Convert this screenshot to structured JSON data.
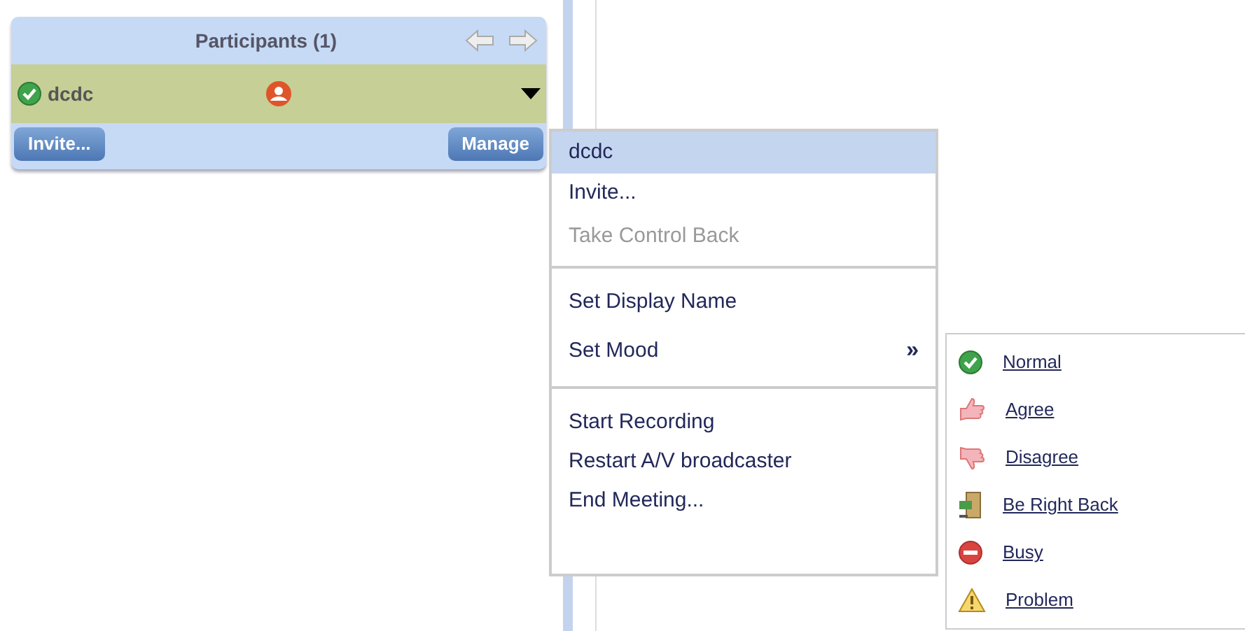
{
  "panel": {
    "title": "Participants (1)",
    "participants": [
      {
        "name": "dcdc",
        "selected": true
      }
    ],
    "buttons": [
      "Invite...",
      "Manage"
    ]
  },
  "menu": {
    "items": [
      {
        "kind": "header",
        "label": "dcdc"
      },
      {
        "kind": "item",
        "label": "Invite...",
        "disabled": false
      },
      {
        "kind": "item",
        "label": "Take Control Back",
        "disabled": true
      },
      {
        "kind": "separator"
      },
      {
        "kind": "item",
        "label": "Set Display Name",
        "disabled": false
      },
      {
        "kind": "submenu",
        "label": "Set Mood",
        "arrow": "»",
        "disabled": false
      },
      {
        "kind": "separator"
      },
      {
        "kind": "item",
        "label": "Start Recording",
        "disabled": false
      },
      {
        "kind": "item",
        "label": "Restart A/V broadcaster",
        "disabled": false
      },
      {
        "kind": "item",
        "label": "End Meeting...",
        "disabled": false
      }
    ]
  },
  "mood_menu": {
    "items": [
      {
        "kind": "normal",
        "label": "Normal"
      },
      {
        "kind": "agree",
        "label": "Agree"
      },
      {
        "kind": "disagree",
        "label": "Disagree"
      },
      {
        "kind": "away",
        "label": "Be Right Back"
      },
      {
        "kind": "busy",
        "label": "Busy"
      },
      {
        "kind": "problem",
        "label": "Problem"
      }
    ]
  }
}
